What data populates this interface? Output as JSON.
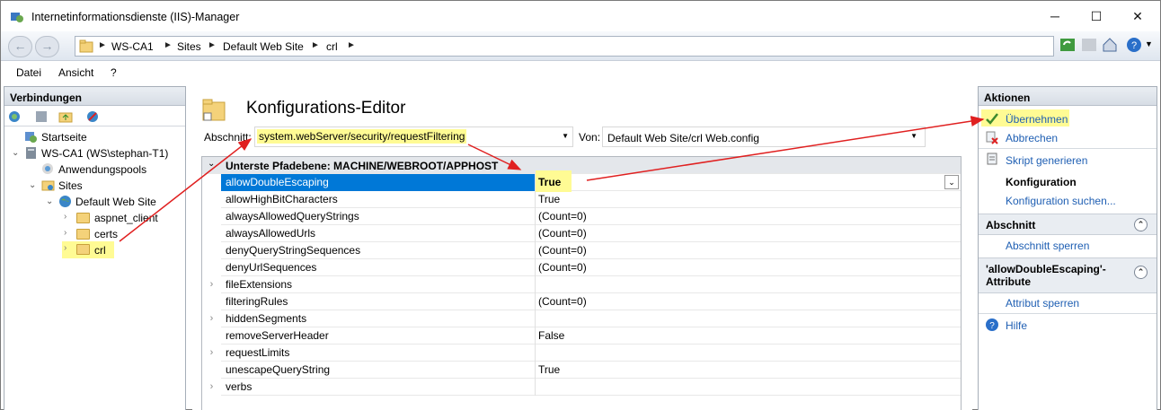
{
  "window": {
    "title": "Internetinformationsdienste (IIS)-Manager",
    "minimize": "─",
    "maximize": "☐",
    "close": "✕"
  },
  "address": {
    "crumbs": [
      "WS-CA1",
      "Sites",
      "Default Web Site",
      "crl"
    ]
  },
  "menu": {
    "items": [
      "Datei",
      "Ansicht",
      "?"
    ]
  },
  "connections": {
    "title": "Verbindungen",
    "tree": [
      {
        "label": "Startseite",
        "depth": 0
      },
      {
        "label": "WS-CA1 (WS\\stephan-T1)",
        "depth": 0
      },
      {
        "label": "Anwendungspools",
        "depth": 1
      },
      {
        "label": "Sites",
        "depth": 1
      },
      {
        "label": "Default Web Site",
        "depth": 2
      },
      {
        "label": "aspnet_client",
        "depth": 3
      },
      {
        "label": "certs",
        "depth": 3
      },
      {
        "label": "crl",
        "depth": 3
      }
    ]
  },
  "editor": {
    "title": "Konfigurations-Editor",
    "section_label": "Abschnitt:",
    "section_value": "system.webServer/security/requestFiltering",
    "from_label": "Von:",
    "from_value": "Default Web Site/crl Web.config",
    "group_header": "Unterste Pfadebene: MACHINE/WEBROOT/APPHOST",
    "rows": [
      {
        "name": "allowDoubleEscaping",
        "value": "True"
      },
      {
        "name": "allowHighBitCharacters",
        "value": "True"
      },
      {
        "name": "alwaysAllowedQueryStrings",
        "value": "(Count=0)"
      },
      {
        "name": "alwaysAllowedUrls",
        "value": "(Count=0)"
      },
      {
        "name": "denyQueryStringSequences",
        "value": "(Count=0)"
      },
      {
        "name": "denyUrlSequences",
        "value": "(Count=0)"
      },
      {
        "name": "fileExtensions",
        "value": ""
      },
      {
        "name": "filteringRules",
        "value": "(Count=0)"
      },
      {
        "name": "hiddenSegments",
        "value": ""
      },
      {
        "name": "removeServerHeader",
        "value": "False"
      },
      {
        "name": "requestLimits",
        "value": ""
      },
      {
        "name": "unescapeQueryString",
        "value": "True"
      },
      {
        "name": "verbs",
        "value": ""
      }
    ]
  },
  "actions": {
    "title": "Aktionen",
    "apply": "Übernehmen",
    "cancel": "Abbrechen",
    "script": "Skript generieren",
    "config_heading": "Konfiguration",
    "config_search": "Konfiguration suchen...",
    "section_heading": "Abschnitt",
    "section_lock": "Abschnitt sperren",
    "attr_heading": "'allowDoubleEscaping'-Attribute",
    "attr_lock": "Attribut sperren",
    "help": "Hilfe"
  },
  "colors": {
    "selection": "#0078d7",
    "highlight": "#fffb94",
    "link": "#1f5fb3",
    "arrow": "#e02020"
  }
}
